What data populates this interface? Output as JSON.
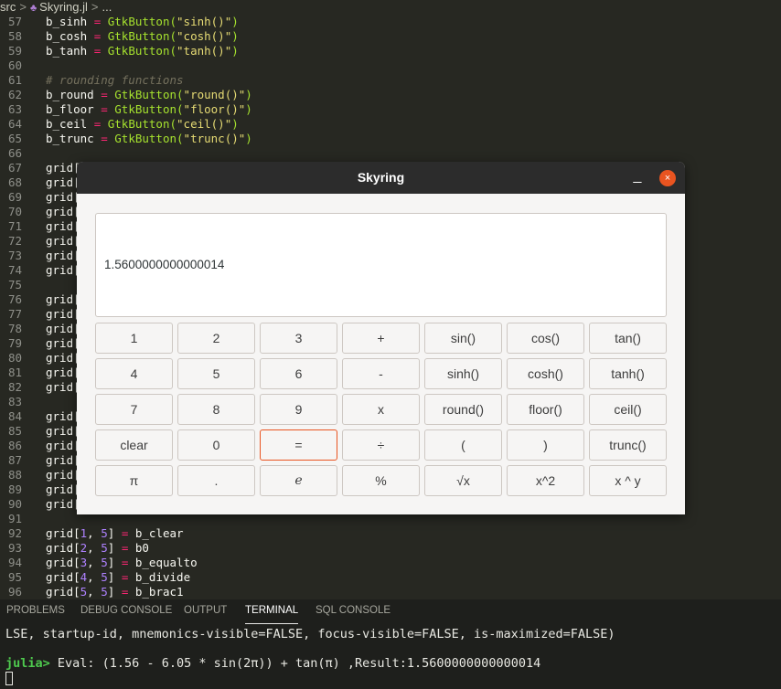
{
  "breadcrumb": {
    "folder": "src",
    "sep1": ">",
    "file": "Skyring.jl",
    "sep2": ">",
    "more": "..."
  },
  "editor_lines": [
    {
      "n": "57",
      "t": 0,
      "parts": [
        [
          "b_sinh ",
          ""
        ],
        [
          "=",
          "kw"
        ],
        [
          " GtkButton(",
          "fn"
        ],
        [
          "\"sinh()\"",
          "str"
        ],
        [
          ")",
          "fn"
        ]
      ]
    },
    {
      "n": "58",
      "t": 16,
      "parts": [
        [
          "b_cosh ",
          ""
        ],
        [
          "=",
          "kw"
        ],
        [
          " GtkButton(",
          "fn"
        ],
        [
          "\"cosh()\"",
          "str"
        ],
        [
          ")",
          "fn"
        ]
      ]
    },
    {
      "n": "59",
      "t": 32,
      "parts": [
        [
          "b_tanh ",
          ""
        ],
        [
          "=",
          "kw"
        ],
        [
          " GtkButton(",
          "fn"
        ],
        [
          "\"tanh()\"",
          "str"
        ],
        [
          ")",
          "fn"
        ]
      ]
    },
    {
      "n": "60",
      "t": 48,
      "parts": []
    },
    {
      "n": "61",
      "t": 64,
      "parts": [
        [
          "# rounding functions",
          "cm"
        ]
      ]
    },
    {
      "n": "62",
      "t": 80,
      "parts": [
        [
          "b_round ",
          ""
        ],
        [
          "=",
          "kw"
        ],
        [
          " GtkButton(",
          "fn"
        ],
        [
          "\"round()\"",
          "str"
        ],
        [
          ")",
          "fn"
        ]
      ]
    },
    {
      "n": "63",
      "t": 96,
      "parts": [
        [
          "b_floor ",
          ""
        ],
        [
          "=",
          "kw"
        ],
        [
          " GtkButton(",
          "fn"
        ],
        [
          "\"floor()\"",
          "str"
        ],
        [
          ")",
          "fn"
        ]
      ]
    },
    {
      "n": "64",
      "t": 112,
      "parts": [
        [
          "b_ceil ",
          ""
        ],
        [
          "=",
          "kw"
        ],
        [
          " GtkButton(",
          "fn"
        ],
        [
          "\"ceil()\"",
          "str"
        ],
        [
          ")",
          "fn"
        ]
      ]
    },
    {
      "n": "65",
      "t": 128,
      "parts": [
        [
          "b_trunc ",
          ""
        ],
        [
          "=",
          "kw"
        ],
        [
          " GtkButton(",
          "fn"
        ],
        [
          "\"trunc()\"",
          "str"
        ],
        [
          ")",
          "fn"
        ]
      ]
    },
    {
      "n": "66",
      "t": 144,
      "parts": []
    },
    {
      "n": "67",
      "t": 160,
      "parts": [
        [
          "grid[",
          ""
        ]
      ]
    },
    {
      "n": "68",
      "t": 176,
      "parts": [
        [
          "grid[",
          ""
        ]
      ]
    },
    {
      "n": "69",
      "t": 192,
      "parts": [
        [
          "grid[",
          ""
        ]
      ]
    },
    {
      "n": "70",
      "t": 208,
      "parts": [
        [
          "grid[",
          ""
        ]
      ]
    },
    {
      "n": "71",
      "t": 224,
      "parts": [
        [
          "grid[",
          ""
        ]
      ]
    },
    {
      "n": "72",
      "t": 240,
      "parts": [
        [
          "grid[",
          ""
        ]
      ]
    },
    {
      "n": "73",
      "t": 256,
      "parts": [
        [
          "grid[",
          ""
        ]
      ]
    },
    {
      "n": "74",
      "t": 272,
      "parts": [
        [
          "grid[",
          ""
        ]
      ]
    },
    {
      "n": "75",
      "t": 288,
      "parts": []
    },
    {
      "n": "76",
      "t": 304,
      "parts": [
        [
          "grid[",
          ""
        ]
      ]
    },
    {
      "n": "77",
      "t": 320,
      "parts": [
        [
          "grid[",
          ""
        ]
      ]
    },
    {
      "n": "78",
      "t": 336,
      "parts": [
        [
          "grid[",
          ""
        ]
      ]
    },
    {
      "n": "79",
      "t": 352,
      "parts": [
        [
          "grid[",
          ""
        ]
      ]
    },
    {
      "n": "80",
      "t": 368,
      "parts": [
        [
          "grid[",
          ""
        ]
      ]
    },
    {
      "n": "81",
      "t": 384,
      "parts": [
        [
          "grid[",
          ""
        ]
      ]
    },
    {
      "n": "82",
      "t": 400,
      "parts": [
        [
          "grid[",
          ""
        ]
      ]
    },
    {
      "n": "83",
      "t": 416,
      "parts": []
    },
    {
      "n": "84",
      "t": 432,
      "parts": [
        [
          "grid[",
          ""
        ]
      ]
    },
    {
      "n": "85",
      "t": 448,
      "parts": [
        [
          "grid[",
          ""
        ]
      ]
    },
    {
      "n": "86",
      "t": 464,
      "parts": [
        [
          "grid[",
          ""
        ]
      ]
    },
    {
      "n": "87",
      "t": 480,
      "parts": [
        [
          "grid[",
          ""
        ]
      ]
    },
    {
      "n": "88",
      "t": 496,
      "parts": [
        [
          "grid[",
          ""
        ]
      ]
    },
    {
      "n": "89",
      "t": 512,
      "parts": [
        [
          "grid[",
          ""
        ]
      ]
    },
    {
      "n": "90",
      "t": 528,
      "parts": [
        [
          "grid[",
          ""
        ]
      ]
    },
    {
      "n": "91",
      "t": 544,
      "parts": []
    },
    {
      "n": "92",
      "t": 560,
      "parts": [
        [
          "grid[",
          ""
        ],
        [
          "1",
          "num"
        ],
        [
          ", ",
          ""
        ],
        [
          "5",
          "num"
        ],
        [
          "] ",
          ""
        ],
        [
          "=",
          "kw"
        ],
        [
          " b_clear",
          ""
        ]
      ]
    },
    {
      "n": "93",
      "t": 576,
      "parts": [
        [
          "grid[",
          ""
        ],
        [
          "2",
          "num"
        ],
        [
          ", ",
          ""
        ],
        [
          "5",
          "num"
        ],
        [
          "] ",
          ""
        ],
        [
          "=",
          "kw"
        ],
        [
          " b0",
          ""
        ]
      ]
    },
    {
      "n": "94",
      "t": 592,
      "parts": [
        [
          "grid[",
          ""
        ],
        [
          "3",
          "num"
        ],
        [
          ", ",
          ""
        ],
        [
          "5",
          "num"
        ],
        [
          "] ",
          ""
        ],
        [
          "=",
          "kw"
        ],
        [
          " b_equalto",
          ""
        ]
      ]
    },
    {
      "n": "95",
      "t": 608,
      "parts": [
        [
          "grid[",
          ""
        ],
        [
          "4",
          "num"
        ],
        [
          ", ",
          ""
        ],
        [
          "5",
          "num"
        ],
        [
          "] ",
          ""
        ],
        [
          "=",
          "kw"
        ],
        [
          " b_divide",
          ""
        ]
      ]
    },
    {
      "n": "96",
      "t": 624,
      "parts": [
        [
          "grid[",
          ""
        ],
        [
          "5",
          "num"
        ],
        [
          ", ",
          ""
        ],
        [
          "5",
          "num"
        ],
        [
          "] ",
          ""
        ],
        [
          "=",
          "kw"
        ],
        [
          " b_brac1",
          ""
        ]
      ]
    }
  ],
  "window": {
    "title": "Skyring",
    "minimize": "_",
    "close": "×",
    "display": "1.5600000000000014",
    "focused_key": "=",
    "keys": [
      [
        "1",
        "2",
        "3",
        "+",
        "sin()",
        "cos()",
        "tan()"
      ],
      [
        "4",
        "5",
        "6",
        "-",
        "sinh()",
        "cosh()",
        "tanh()"
      ],
      [
        "7",
        "8",
        "9",
        "x",
        "round()",
        "floor()",
        "ceil()"
      ],
      [
        "clear",
        "0",
        "=",
        "÷",
        "(",
        ")",
        "trunc()"
      ],
      [
        "π",
        ".",
        "e",
        "%",
        "√x",
        "x^2",
        "x ^ y"
      ]
    ]
  },
  "panel": {
    "tabs": [
      "PROBLEMS",
      "DEBUG CONSOLE",
      "OUTPUT",
      "TERMINAL",
      "SQL CONSOLE"
    ],
    "active_tab": "TERMINAL",
    "terminal_line1": "LSE, startup-id, mnemonics-visible=FALSE, focus-visible=FALSE, is-maximized=FALSE)",
    "prompt": "julia>",
    "terminal_line2": " Eval: (1.56 - 6.05 * sin(2π)) + tan(π) ,Result:1.5600000000000014"
  }
}
